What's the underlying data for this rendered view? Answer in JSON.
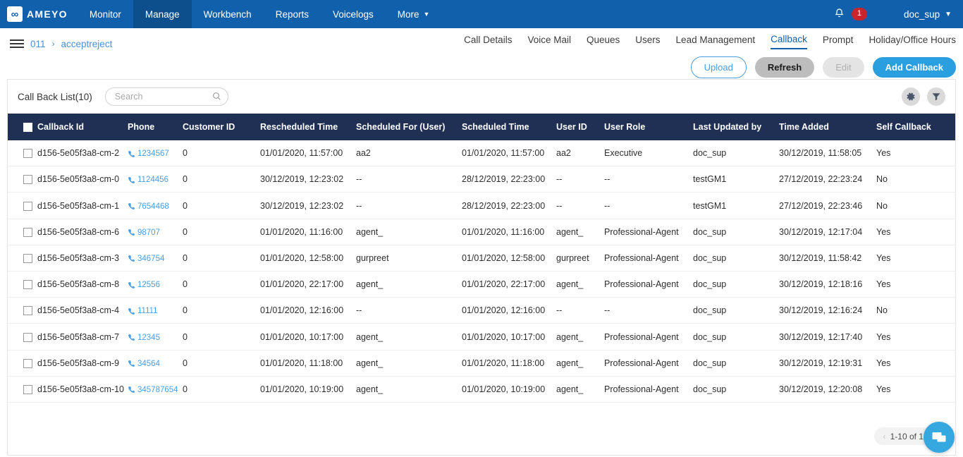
{
  "topnav": {
    "brand": {
      "logo_icon": "ameyo-infinity-logo",
      "name": "AMEYO"
    },
    "items": [
      {
        "label": "Monitor",
        "active": false
      },
      {
        "label": "Manage",
        "active": true
      },
      {
        "label": "Workbench",
        "active": false
      },
      {
        "label": "Reports",
        "active": false
      },
      {
        "label": "Voicelogs",
        "active": false
      },
      {
        "label": "More",
        "active": false,
        "caret": "▼"
      }
    ],
    "notification": {
      "icon": "bell-icon",
      "count": "1"
    },
    "user": {
      "name": "doc_sup",
      "caret": "▼"
    },
    "bg_color": "#1160ac",
    "active_bg_color": "#0d4e8c"
  },
  "breadcrumb": {
    "menu_icon": "hamburger-menu-icon",
    "root": "011",
    "separator": "›",
    "current": "acceptreject"
  },
  "subnav": {
    "items": [
      {
        "label": "Call Details",
        "active": false
      },
      {
        "label": "Voice Mail",
        "active": false
      },
      {
        "label": "Queues",
        "active": false
      },
      {
        "label": "Users",
        "active": false
      },
      {
        "label": "Lead Management",
        "active": false
      },
      {
        "label": "Callback",
        "active": true
      },
      {
        "label": "Prompt",
        "active": false
      },
      {
        "label": "Holiday/Office Hours",
        "active": false
      }
    ],
    "active_color": "#1160ac"
  },
  "actions": {
    "upload": "Upload",
    "refresh": "Refresh",
    "edit": "Edit",
    "add_callback": "Add Callback",
    "add_color": "#2a9fe0"
  },
  "list_header": {
    "title": "Call Back List(10)",
    "search_placeholder": "Search",
    "search_value": "",
    "search_icon": "search-icon",
    "settings_icon": "gear-icon",
    "filter_icon": "funnel-filter-icon"
  },
  "table": {
    "header_bg": "#1f3054",
    "columns": [
      "Callback Id",
      "Phone",
      "Customer ID",
      "Rescheduled Time",
      "Scheduled For (User)",
      "Scheduled Time",
      "User ID",
      "User Role",
      "Last Updated by",
      "Time Added",
      "Self Callback"
    ],
    "rows": [
      {
        "callback_id": "d156-5e05f3a8-cm-2",
        "phone": "1234567",
        "customer_id": "0",
        "rescheduled_time": "01/01/2020, 11:57:00",
        "scheduled_for_user": "aa2",
        "scheduled_time": "01/01/2020, 11:57:00",
        "user_id": "aa2",
        "user_role": "Executive",
        "last_updated_by": "doc_sup",
        "time_added": "30/12/2019, 11:58:05",
        "self_callback": "Yes"
      },
      {
        "callback_id": "d156-5e05f3a8-cm-0",
        "phone": "1124456",
        "customer_id": "0",
        "rescheduled_time": "30/12/2019, 12:23:02",
        "scheduled_for_user": "--",
        "scheduled_time": "28/12/2019, 22:23:00",
        "user_id": "--",
        "user_role": "--",
        "last_updated_by": "testGM1",
        "time_added": "27/12/2019, 22:23:24",
        "self_callback": "No"
      },
      {
        "callback_id": "d156-5e05f3a8-cm-1",
        "phone": "7654468",
        "customer_id": "0",
        "rescheduled_time": "30/12/2019, 12:23:02",
        "scheduled_for_user": "--",
        "scheduled_time": "28/12/2019, 22:23:00",
        "user_id": "--",
        "user_role": "--",
        "last_updated_by": "testGM1",
        "time_added": "27/12/2019, 22:23:46",
        "self_callback": "No"
      },
      {
        "callback_id": "d156-5e05f3a8-cm-6",
        "phone": "98707",
        "customer_id": "0",
        "rescheduled_time": "01/01/2020, 11:16:00",
        "scheduled_for_user": "agent_",
        "scheduled_time": "01/01/2020, 11:16:00",
        "user_id": "agent_",
        "user_role": "Professional-Agent",
        "last_updated_by": "doc_sup",
        "time_added": "30/12/2019, 12:17:04",
        "self_callback": "Yes"
      },
      {
        "callback_id": "d156-5e05f3a8-cm-3",
        "phone": "346754",
        "customer_id": "0",
        "rescheduled_time": "01/01/2020, 12:58:00",
        "scheduled_for_user": "gurpreet",
        "scheduled_time": "01/01/2020, 12:58:00",
        "user_id": "gurpreet",
        "user_role": "Professional-Agent",
        "last_updated_by": "doc_sup",
        "time_added": "30/12/2019, 11:58:42",
        "self_callback": "Yes"
      },
      {
        "callback_id": "d156-5e05f3a8-cm-8",
        "phone": "12556",
        "customer_id": "0",
        "rescheduled_time": "01/01/2020, 22:17:00",
        "scheduled_for_user": "agent_",
        "scheduled_time": "01/01/2020, 22:17:00",
        "user_id": "agent_",
        "user_role": "Professional-Agent",
        "last_updated_by": "doc_sup",
        "time_added": "30/12/2019, 12:18:16",
        "self_callback": "Yes"
      },
      {
        "callback_id": "d156-5e05f3a8-cm-4",
        "phone": "11111",
        "customer_id": "0",
        "rescheduled_time": "01/01/2020, 12:16:00",
        "scheduled_for_user": "--",
        "scheduled_time": "01/01/2020, 12:16:00",
        "user_id": "--",
        "user_role": "--",
        "last_updated_by": "doc_sup",
        "time_added": "30/12/2019, 12:16:24",
        "self_callback": "No"
      },
      {
        "callback_id": "d156-5e05f3a8-cm-7",
        "phone": "12345",
        "customer_id": "0",
        "rescheduled_time": "01/01/2020, 10:17:00",
        "scheduled_for_user": "agent_",
        "scheduled_time": "01/01/2020, 10:17:00",
        "user_id": "agent_",
        "user_role": "Professional-Agent",
        "last_updated_by": "doc_sup",
        "time_added": "30/12/2019, 12:17:40",
        "self_callback": "Yes"
      },
      {
        "callback_id": "d156-5e05f3a8-cm-9",
        "phone": "34564",
        "customer_id": "0",
        "rescheduled_time": "01/01/2020, 11:18:00",
        "scheduled_for_user": "agent_",
        "scheduled_time": "01/01/2020, 11:18:00",
        "user_id": "agent_",
        "user_role": "Professional-Agent",
        "last_updated_by": "doc_sup",
        "time_added": "30/12/2019, 12:19:31",
        "self_callback": "Yes"
      },
      {
        "callback_id": "d156-5e05f3a8-cm-10",
        "phone": "345787654",
        "customer_id": "0",
        "rescheduled_time": "01/01/2020, 10:19:00",
        "scheduled_for_user": "agent_",
        "scheduled_time": "01/01/2020, 10:19:00",
        "user_id": "agent_",
        "user_role": "Professional-Agent",
        "last_updated_by": "doc_sup",
        "time_added": "30/12/2019, 12:20:08",
        "self_callback": "Yes"
      }
    ]
  },
  "pagination": {
    "prev_icon": "chevron-left-icon",
    "next_icon": "chevron-right-icon",
    "range_text": "1-10 of 10"
  },
  "chat": {
    "icon": "chat-bubbles-icon",
    "color": "#35a8e0"
  }
}
